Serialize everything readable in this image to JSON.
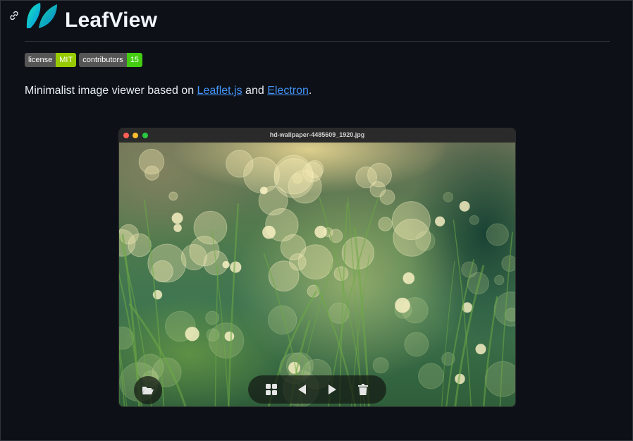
{
  "header": {
    "title": "LeafView",
    "anchor_icon": "link-icon",
    "logo_icon": "leaf-logo-icon"
  },
  "badges": [
    {
      "label": "license",
      "value": "MIT",
      "color": "#97ca00"
    },
    {
      "label": "contributors",
      "value": "15",
      "color": "#4c1"
    }
  ],
  "description": {
    "prefix": "Minimalist image viewer based on ",
    "link1": "Leaflet.js",
    "middle": " and ",
    "link2": "Electron",
    "suffix": "."
  },
  "app_window": {
    "title": "hd-wallpaper-4485609_1920.jpg",
    "controls": {
      "open_folder_icon": "folder-open-icon",
      "grid_icon": "grid-icon",
      "prev_icon": "prev-arrow-icon",
      "next_icon": "next-arrow-icon",
      "trash_icon": "trash-icon"
    }
  },
  "colors": {
    "background": "#0d1117",
    "link": "#4493f8",
    "logo_from": "#1de9b6",
    "logo_to": "#00b0ff"
  }
}
